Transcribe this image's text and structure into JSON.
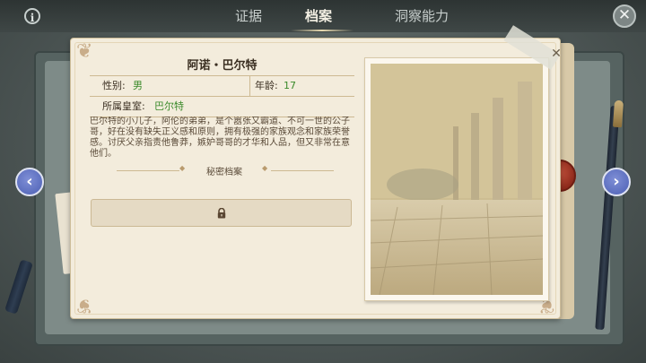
{
  "window": {
    "info_icon_glyph": "i",
    "close_icon_glyph": "✕"
  },
  "tabs": [
    {
      "label": "证据",
      "active": false
    },
    {
      "label": "档案",
      "active": true
    },
    {
      "label": "洞察能力",
      "active": false
    }
  ],
  "profile": {
    "name": "阿诺・巴尔特",
    "gender_label": "性别:",
    "gender_value": "男",
    "age_label": "年龄:",
    "age_value": "17",
    "house_label": "所属皇室:",
    "house_value": "巴尔特",
    "description": "巴尔特的小儿子，阿伦的弟弟，是个嚣张又霸道、不可一世的公子哥，好在没有缺失正义感和原则，拥有极强的家族观念和家族荣誉感。讨厌父亲指责他鲁莽，嫉妒哥哥的才华和人品，但又非常在意他们。",
    "secret_label": "秘密档案",
    "secret_locked": true
  },
  "card": {
    "close_glyph": "✕"
  },
  "navigation": {
    "prev_glyph": "‹",
    "next_glyph": "›"
  },
  "colors": {
    "value_green": "#3a8a2a",
    "arrow_blue": "#5366bd",
    "paper": "#f3ecdc"
  },
  "icons": {
    "info": "info-icon",
    "close": "close-icon",
    "lock": "lock-icon",
    "prev": "arrow-left-icon",
    "next": "arrow-right-icon"
  }
}
